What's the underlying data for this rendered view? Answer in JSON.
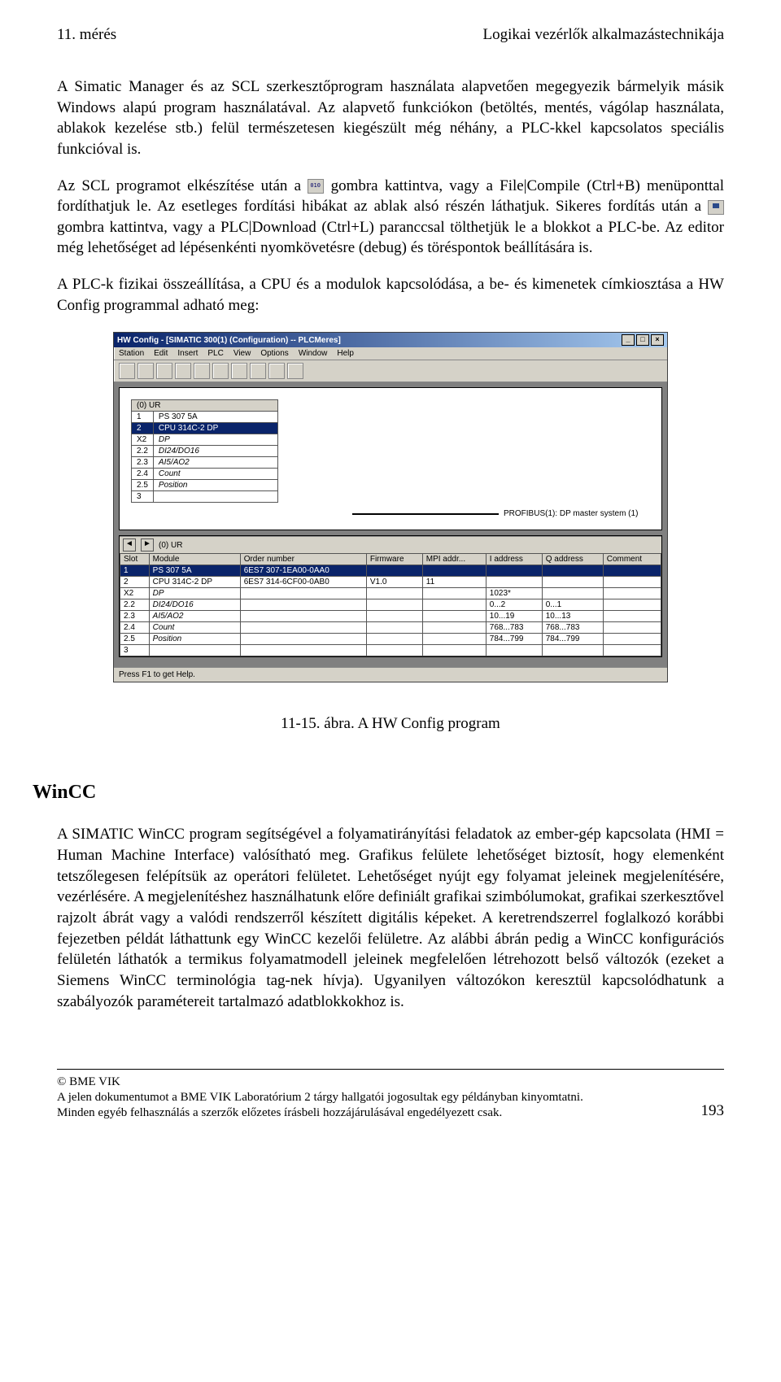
{
  "header": {
    "left": "11. mérés",
    "right": "Logikai vezérlők alkalmazástechnikája"
  },
  "paragraphs": {
    "p1": "A Simatic Manager és az SCL szerkesztőprogram használata alapvetően megegyezik bármelyik másik Windows alapú program használatával. Az alapvető funkciókon (betöltés, mentés, vágólap használata, ablakok kezelése stb.) felül természetesen kiegészült még néhány, a PLC-kkel kapcsolatos speciális funkcióval is.",
    "p2a": "Az SCL programot elkészítése után a ",
    "p2b": " gombra kattintva, vagy a File|Compile (Ctrl+B) menüponttal fordíthatjuk le. Az esetleges fordítási hibákat az ablak alsó részén láthatjuk. Sikeres fordítás után a ",
    "p2c": " gombra kattintva, vagy a PLC|Download (Ctrl+L) paranccsal tölthetjük le a blokkot a PLC-be. Az editor még lehetőséget ad lépésenkénti nyomkövetésre (debug) és töréspontok beállítására is.",
    "p3": "A PLC-k fizikai összeállítása, a CPU és a modulok kapcsolódása, a be- és kimenetek címkiosztása a HW Config programmal adható meg:",
    "caption": "11-15. ábra. A HW Config program",
    "section": "WinCC",
    "p4": "A SIMATIC WinCC program segítségével a folyamatirányítási feladatok az ember-gép kapcsolata (HMI = Human Machine Interface) valósítható meg. Grafikus felülete lehetőséget biztosít, hogy elemenként tetszőlegesen felépítsük az operátori felületet. Lehetőséget nyújt egy folyamat jeleinek megjelenítésére, vezérlésére. A megjelenítéshez használhatunk előre definiált grafikai szimbólumokat, grafikai szerkesztővel rajzolt ábrát vagy a valódi rendszerről készített digitális képeket. A keretrendszerrel foglalkozó korábbi fejezetben példát láthattunk egy WinCC kezelői felületre. Az alábbi ábrán pedig a WinCC konfigurációs felületén láthatók a termikus folyamatmodell jeleinek megfelelően létrehozott belső változók (ezeket a Siemens WinCC terminológia tag-nek hívja). Ugyanilyen változókon keresztül kapcsolódhatunk a szabályozók paramétereit tartalmazó adatblokkokhoz is."
  },
  "hwconfig": {
    "title": "HW Config - [SIMATIC 300(1) (Configuration) -- PLCMeres]",
    "menu": [
      "Station",
      "Edit",
      "Insert",
      "PLC",
      "View",
      "Options",
      "Window",
      "Help"
    ],
    "rack_label": "(0) UR",
    "rack_rows": [
      {
        "slot": "1",
        "module": "PS 307 5A"
      },
      {
        "slot": "2",
        "module": "CPU 314C-2 DP"
      },
      {
        "slot": "X2",
        "module": "DP"
      },
      {
        "slot": "2.2",
        "module": "DI24/DO16"
      },
      {
        "slot": "2.3",
        "module": "AI5/AO2"
      },
      {
        "slot": "2.4",
        "module": "Count"
      },
      {
        "slot": "2.5",
        "module": "Position"
      },
      {
        "slot": "3",
        "module": ""
      }
    ],
    "profibus_label": "PROFIBUS(1): DP master system (1)",
    "lower_label": "(0)  UR",
    "columns": [
      "Slot",
      "Module",
      "Order number",
      "Firmware",
      "MPI addr...",
      "I address",
      "Q address",
      "Comment"
    ],
    "rows": [
      {
        "slot": "1",
        "module": "PS 307 5A",
        "order": "6ES7 307-1EA00-0AA0",
        "fw": "",
        "mpi": "",
        "iaddr": "",
        "qaddr": "",
        "comment": ""
      },
      {
        "slot": "2",
        "module": "CPU 314C-2 DP",
        "order": "6ES7 314-6CF00-0AB0",
        "fw": "V1.0",
        "mpi": "11",
        "iaddr": "",
        "qaddr": "",
        "comment": ""
      },
      {
        "slot": "X2",
        "module": "DP",
        "order": "",
        "fw": "",
        "mpi": "",
        "iaddr": "1023*",
        "qaddr": "",
        "comment": ""
      },
      {
        "slot": "2.2",
        "module": "DI24/DO16",
        "order": "",
        "fw": "",
        "mpi": "",
        "iaddr": "0...2",
        "qaddr": "0...1",
        "comment": ""
      },
      {
        "slot": "2.3",
        "module": "AI5/AO2",
        "order": "",
        "fw": "",
        "mpi": "",
        "iaddr": "10...19",
        "qaddr": "10...13",
        "comment": ""
      },
      {
        "slot": "2.4",
        "module": "Count",
        "order": "",
        "fw": "",
        "mpi": "",
        "iaddr": "768...783",
        "qaddr": "768...783",
        "comment": ""
      },
      {
        "slot": "2.5",
        "module": "Position",
        "order": "",
        "fw": "",
        "mpi": "",
        "iaddr": "784...799",
        "qaddr": "784...799",
        "comment": ""
      },
      {
        "slot": "3",
        "module": "",
        "order": "",
        "fw": "",
        "mpi": "",
        "iaddr": "",
        "qaddr": "",
        "comment": ""
      }
    ],
    "status": "Press F1 to get Help."
  },
  "footer": {
    "l1": "© BME VIK",
    "l2": "A jelen dokumentumot a BME VIK Laboratórium 2 tárgy hallgatói jogosultak egy példányban kinyomtatni.",
    "l3": "Minden egyéb felhasználás a szerzők előzetes írásbeli hozzájárulásával engedélyezett csak.",
    "page": "193"
  }
}
